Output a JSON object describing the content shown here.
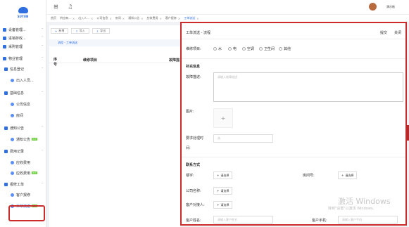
{
  "sidebar": {
    "logo_text": "SUYUN",
    "items": [
      {
        "label": "设备管理...",
        "level": 1
      },
      {
        "label": "进销存收...",
        "level": 1
      },
      {
        "label": "采购管理",
        "level": 1
      },
      {
        "label": "物业管理",
        "level": 1
      },
      {
        "label": "信息登记",
        "level": 2
      },
      {
        "label": "出入人员...",
        "level": 3
      },
      {
        "label": "基础信息",
        "level": 2
      },
      {
        "label": "公司信息",
        "level": 3
      },
      {
        "label": "房间",
        "level": 3
      },
      {
        "label": "通知公告",
        "level": 2
      },
      {
        "label": "通知公告",
        "level": 3,
        "badge": "新增"
      },
      {
        "label": "费用记录",
        "level": 2
      },
      {
        "label": "应收费用",
        "level": 3
      },
      {
        "label": "应收费用",
        "level": 3,
        "badge": "新增"
      },
      {
        "label": "报修工单",
        "level": 2
      },
      {
        "label": "客户报修",
        "level": 3
      },
      {
        "label": "工单流送",
        "level": 3,
        "badge": "新增",
        "active": true
      }
    ]
  },
  "topbar": {
    "username": "演示账"
  },
  "tabs": [
    {
      "label": "首页"
    },
    {
      "label": "供应商..."
    },
    {
      "label": "出入人..."
    },
    {
      "label": "公司信息"
    },
    {
      "label": "房间"
    },
    {
      "label": "通知公告"
    },
    {
      "label": "应收费用"
    },
    {
      "label": "客户报修"
    },
    {
      "label": "工单流送",
      "active": true
    }
  ],
  "toolbar": {
    "add": "新增",
    "import": "导入",
    "export": "导出"
  },
  "breadcrumb": "流程 - 工单流送",
  "table": {
    "col1": "序号",
    "col2": "维修项目",
    "col3": "故障描"
  },
  "panel": {
    "title": "工单流送 - 流程",
    "submit": "提交",
    "close": "关闭",
    "repair_item_label": "维修项目:",
    "repair_options": [
      "水",
      "电",
      "空调",
      "卫生间",
      "其他"
    ],
    "supplement_title": "补充信息",
    "fault_desc_label": "故障描述:",
    "fault_desc_placeholder": "请输入故障描述",
    "image_label": "图片:",
    "deadline_label": "要求处理时",
    "deadline_label_2": "间:",
    "deadline_placeholder": "选",
    "contact_title": "联系方式",
    "building_label": "楼宇:",
    "room_label": "房间号:",
    "company_label": "公司名称:",
    "contact_person_label": "客户对接人:",
    "select_label": "请选择",
    "customer_name_label": "客户姓名:",
    "customer_name_placeholder": "请输入客户姓名",
    "customer_phone_label": "客户手机:",
    "customer_phone_placeholder": "请输入客户手机"
  },
  "watermark": {
    "line1": "激活 Windows",
    "line2": "转到\"设置\"以激活 Windows。"
  },
  "colors": {
    "accent": "#2f6fe0",
    "highlight": "#cc2b2b",
    "badge": "#52c41a"
  }
}
